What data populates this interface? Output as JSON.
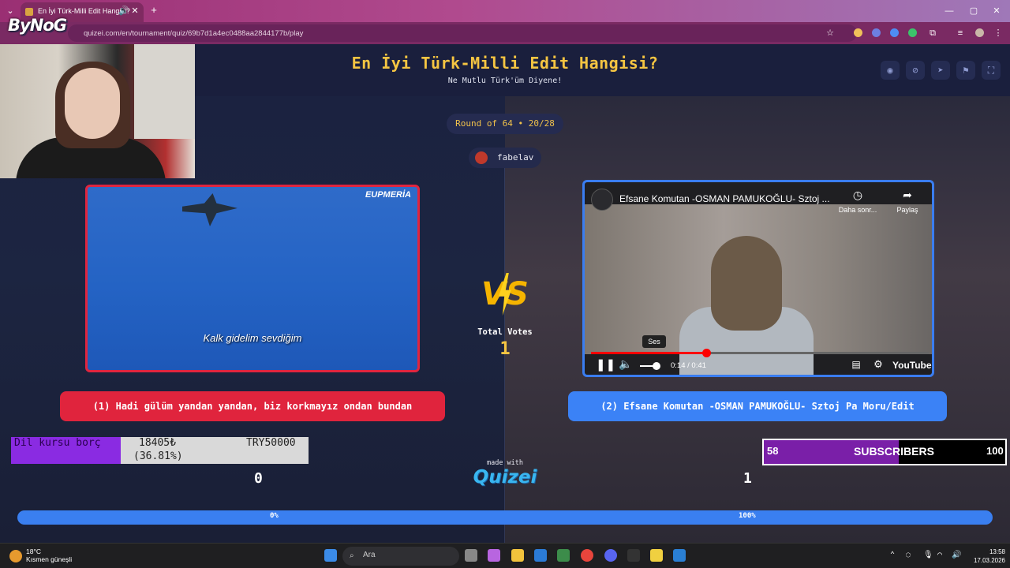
{
  "browser": {
    "tab_title": "En İyi Türk-Milli Edit Hangisi?",
    "url": "quizei.com/en/tournament/quiz/69b7d1a4ec0488aa2844177b/play",
    "new_tab": "+",
    "close_tab": "✕",
    "minimize": "—",
    "maximize": "▢",
    "close": "✕"
  },
  "stream_logo": "ByNoG",
  "page": {
    "title": "En İyi Türk-Milli Edit Hangisi?",
    "subtitle": "Ne Mutlu Türk'üm Diyene!",
    "round": "Round of 64 • 20/28",
    "author": "fabelav",
    "total_votes_label": "Total Votes",
    "total_votes": "1",
    "vs": "VS",
    "made_with": "made with",
    "brand": "Quizei"
  },
  "left": {
    "watermark": "EUPMERİA",
    "subtitle": "Kalk gidelim sevdiğim",
    "option": "(1) Hadi gülüm yandan yandan, biz korkmayız ondan bundan",
    "count": "0",
    "percent_label": "0%"
  },
  "right": {
    "yt_title": "Efsane Komutan -OSMAN PAMUKOĞLU- Sztoj ...",
    "yt_later": "Daha sonr...",
    "yt_share": "Paylaş",
    "yt_tooltip": "Ses",
    "yt_time": "0:14 / 0:41",
    "yt_brand": "YouTube",
    "yt_progress": 0.34,
    "option": "(2) Efsane Komutan -OSMAN PAMUKOĞLU- Sztoj Pa Moru/Edit",
    "count": "1",
    "percent_label": "100%"
  },
  "donation": {
    "label": "Dil kursu borç",
    "amount": "18405₺",
    "percent": "(36.81%)",
    "goal": "TRY50000",
    "progress": 0.3681
  },
  "subs": {
    "min": "58",
    "label": "SUBSCRIBERS",
    "max": "100",
    "progress": 0.56
  },
  "taskbar": {
    "temp": "18°C",
    "weather": "Kısmen güneşli",
    "search_placeholder": "Ara",
    "time": "13:58",
    "date": "17.03.2026"
  },
  "colors": {
    "accent_yellow": "#f5c542",
    "option_left": "#e0243d",
    "option_right": "#3b82f6",
    "youtube_red": "#ff0000"
  }
}
